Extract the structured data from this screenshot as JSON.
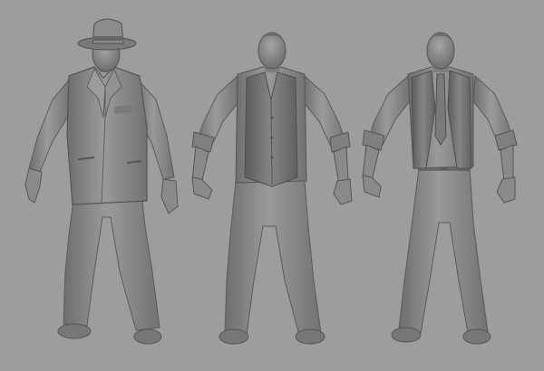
{
  "scene": {
    "background_color": "#9d9d9d",
    "clay_color": "#8c8c8c",
    "figures": [
      {
        "id": "suit-and-hat",
        "outfit": "suit-jacket-with-fedora"
      },
      {
        "id": "vest-and-shirt",
        "outfit": "vest-with-rolled-sleeves"
      },
      {
        "id": "open-vest-with-tie",
        "outfit": "open-vest-with-tie-and-belt"
      }
    ]
  }
}
